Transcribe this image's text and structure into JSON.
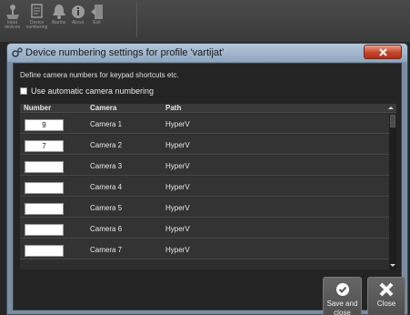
{
  "toolbar": {
    "items": [
      {
        "icon": "joystick-icon",
        "line1": "Input",
        "line2": "devices"
      },
      {
        "icon": "numbering-icon",
        "line1": "Device",
        "line2": "numbering"
      },
      {
        "icon": "bell-icon",
        "line1": "Alarms",
        "line2": ""
      },
      {
        "icon": "info-icon",
        "line1": "About",
        "line2": ""
      },
      {
        "icon": "exit-icon",
        "line1": "Exit",
        "line2": ""
      }
    ]
  },
  "dialog": {
    "title": "Device numbering settings for profile 'vartijat'",
    "intro": "Define camera numbers for keypad shortcuts etc.",
    "auto_numbering_label": "Use automatic camera numbering",
    "columns": {
      "number": "Number",
      "camera": "Camera",
      "path": "Path"
    },
    "rows": [
      {
        "number": "9",
        "camera": "Camera 1",
        "path": "HyperV"
      },
      {
        "number": "7",
        "camera": "Camera 2",
        "path": "HyperV"
      },
      {
        "number": "",
        "camera": "Camera 3",
        "path": "HyperV"
      },
      {
        "number": "",
        "camera": "Camera 4",
        "path": "HyperV"
      },
      {
        "number": "",
        "camera": "Camera 5",
        "path": "HyperV"
      },
      {
        "number": "",
        "camera": "Camera 6",
        "path": "HyperV"
      },
      {
        "number": "",
        "camera": "Camera 7",
        "path": "HyperV"
      }
    ],
    "save_label": "Save and\nclose",
    "close_label": "Close"
  }
}
